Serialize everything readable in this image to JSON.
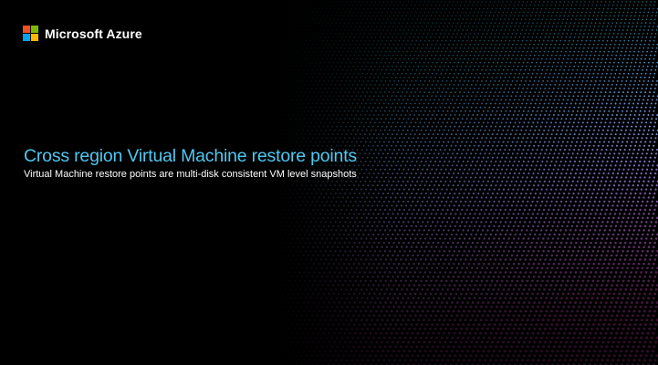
{
  "brand": {
    "name": "Microsoft Azure",
    "logo_icon": "microsoft-logo-icon",
    "logo_colors": [
      "#f25022",
      "#7fba00",
      "#00a4ef",
      "#ffb900"
    ]
  },
  "slide": {
    "title": "Cross region Virtual Machine restore points",
    "subtitle": "Virtual Machine restore points are multi-disk consistent VM level snapshots"
  },
  "colors": {
    "background": "#000000",
    "title": "#50c8f0",
    "subtitle": "#ffffff"
  },
  "background_pattern": "dot-grid-perspective"
}
